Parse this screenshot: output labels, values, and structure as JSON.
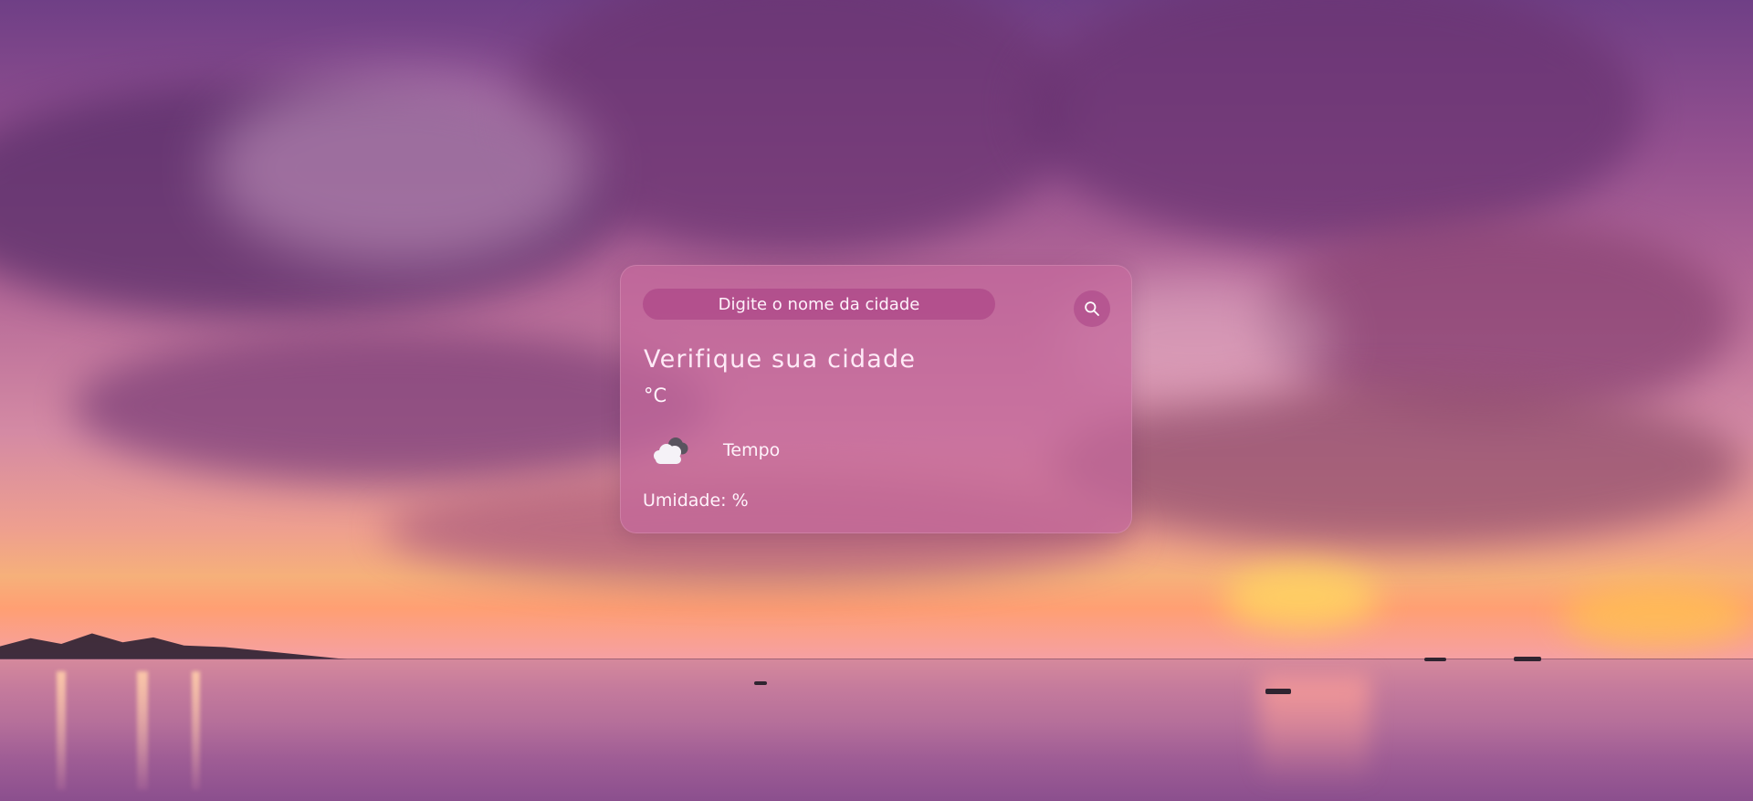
{
  "search": {
    "placeholder": "Digite o nome da cidade"
  },
  "weather": {
    "city_title": "Verifique sua cidade",
    "temperature_text": "°C",
    "description": "Tempo",
    "humidity_text": "Umidade: %"
  },
  "icons": {
    "search": "search-icon",
    "weather": "cloud-icon"
  },
  "colors": {
    "card_background": "#c5699c",
    "search_background": "#ad4888",
    "text": "#fff3fb"
  }
}
